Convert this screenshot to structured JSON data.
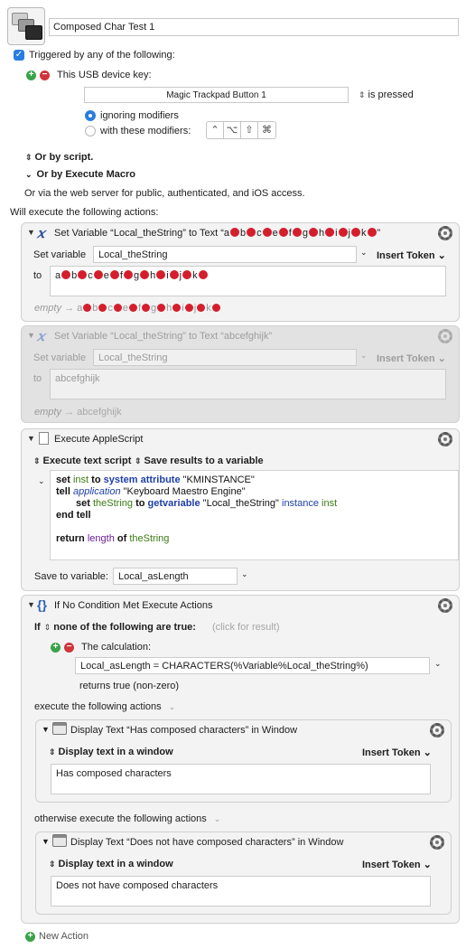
{
  "macro": {
    "name": "Composed Char Test 1"
  },
  "trigger": {
    "checkbox_label": "Triggered by any of the following:",
    "usb_label": "This USB device key:",
    "device_key": "Magic Trackpad Button 1",
    "state": "is pressed",
    "modifier_option_1": "ignoring modifiers",
    "modifier_option_2": "with these modifiers:",
    "modifier_keys": [
      "⌃",
      "⌥",
      "⇧",
      "⌘"
    ],
    "or_by_script": "Or by script.",
    "or_by_execute_macro": "Or by Execute Macro",
    "web_server_text": "Or via the web server for public, authenticated, and iOS access."
  },
  "will_execute": "Will execute the following actions:",
  "action1": {
    "title_prefix": "Set Variable “Local_theString” to Text “a",
    "title_letters": [
      "b",
      "c",
      "e",
      "f",
      "g",
      "h",
      "i",
      "j",
      "k"
    ],
    "title_suffix": "”",
    "set_variable_label": "Set variable",
    "variable_value": "Local_theString",
    "insert_token": "Insert Token",
    "to_label": "to",
    "text_letters": [
      "a",
      "b",
      "c",
      "e",
      "f",
      "g",
      "h",
      "i",
      "j",
      "k"
    ],
    "preview_prefix": "empty",
    "preview_letters": [
      "a",
      "b",
      "c",
      "e",
      "f",
      "g",
      "h",
      "i",
      "j",
      "k"
    ]
  },
  "action2": {
    "title": "Set Variable “Local_theString” to Text “abcefghijk”",
    "set_variable_label": "Set variable",
    "variable_value": "Local_theString",
    "insert_token": "Insert Token",
    "to_label": "to",
    "text_value": "abcefghijk",
    "preview_prefix": "empty",
    "preview_value": "abcefghijk"
  },
  "action3": {
    "title": "Execute AppleScript",
    "execute_option": "Execute text script",
    "save_option": "Save results to a variable",
    "save_label": "Save to variable:",
    "save_value": "Local_asLength"
  },
  "script_lines": {
    "l1_set": "set",
    "l1_inst": "inst",
    "l1_to": "to",
    "l1_sysattr": "system attribute",
    "l1_str": "\"KMINSTANCE\"",
    "l2_tell": "tell",
    "l2_app": "application",
    "l2_str": "\"Keyboard Maestro Engine\"",
    "l3_set": "set",
    "l3_var": "theString",
    "l3_to": "to",
    "l3_cmd": "getvariable",
    "l3_str": "\"Local_theString\"",
    "l3_instance": "instance",
    "l3_inst": "inst",
    "l4_endtell": "end tell",
    "l5_return": "return",
    "l5_length": "length",
    "l5_of": "of",
    "l5_var": "theString"
  },
  "action4": {
    "title": "If No Condition Met Execute Actions",
    "if_label": "If",
    "condition_mode": "none of the following are true:",
    "click_for_result": "(click for result)",
    "calc_label": "The calculation:",
    "calc_value": "Local_asLength = CHARACTERS(%Variable%Local_theString%)",
    "returns_text": "returns true (non-zero)",
    "execute_label": "execute the following actions",
    "otherwise_label": "otherwise execute the following actions"
  },
  "sub1": {
    "title": "Display Text “Has composed characters” in Window",
    "mode": "Display text in a window",
    "insert_token": "Insert Token",
    "text_value": "Has composed characters"
  },
  "sub2": {
    "title": "Display Text “Does not have composed characters” in Window",
    "mode": "Display text in a window",
    "insert_token": "Insert Token",
    "text_value": "Does not have composed characters"
  },
  "new_action": "New Action"
}
